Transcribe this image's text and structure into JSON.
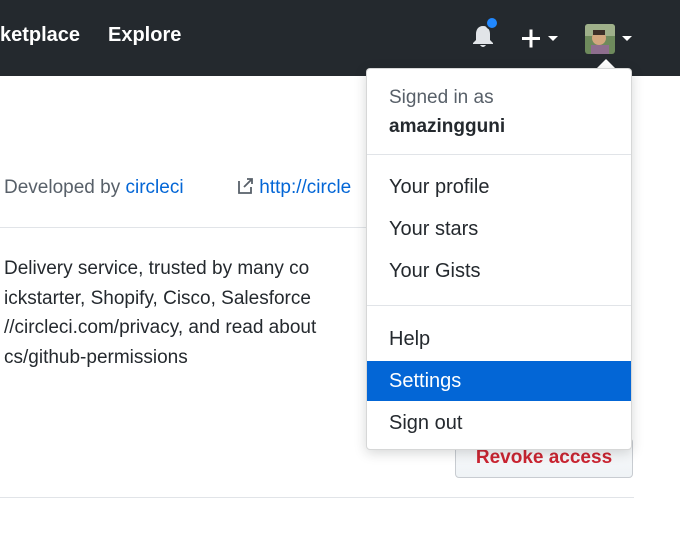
{
  "header": {
    "nav": [
      {
        "label": "ketplace"
      },
      {
        "label": "Explore"
      }
    ],
    "notification_dot_color": "#2188ff",
    "icons": {
      "bell": "bell-icon",
      "plus": "plus-icon",
      "avatar": "avatar"
    }
  },
  "app": {
    "developed_by_prefix": "Developed by",
    "developer": "circleci",
    "website_text": "http://circle",
    "description_lines": [
      "Delivery service, trusted by many co",
      "ickstarter, Shopify, Cisco, Salesforce",
      "//circleci.com/privacy, and read about",
      "cs/github-permissions"
    ],
    "revoke_label": "Revoke access",
    "revoke_color": "#cb2431"
  },
  "dropdown": {
    "signed_in_label": "Signed in as",
    "username": "amazingguni",
    "group1": [
      {
        "label": "Your profile"
      },
      {
        "label": "Your stars"
      },
      {
        "label": "Your Gists"
      }
    ],
    "group2": [
      {
        "label": "Help"
      },
      {
        "label": "Settings",
        "active": true
      },
      {
        "label": "Sign out"
      }
    ],
    "active_color": "#0366d6"
  }
}
